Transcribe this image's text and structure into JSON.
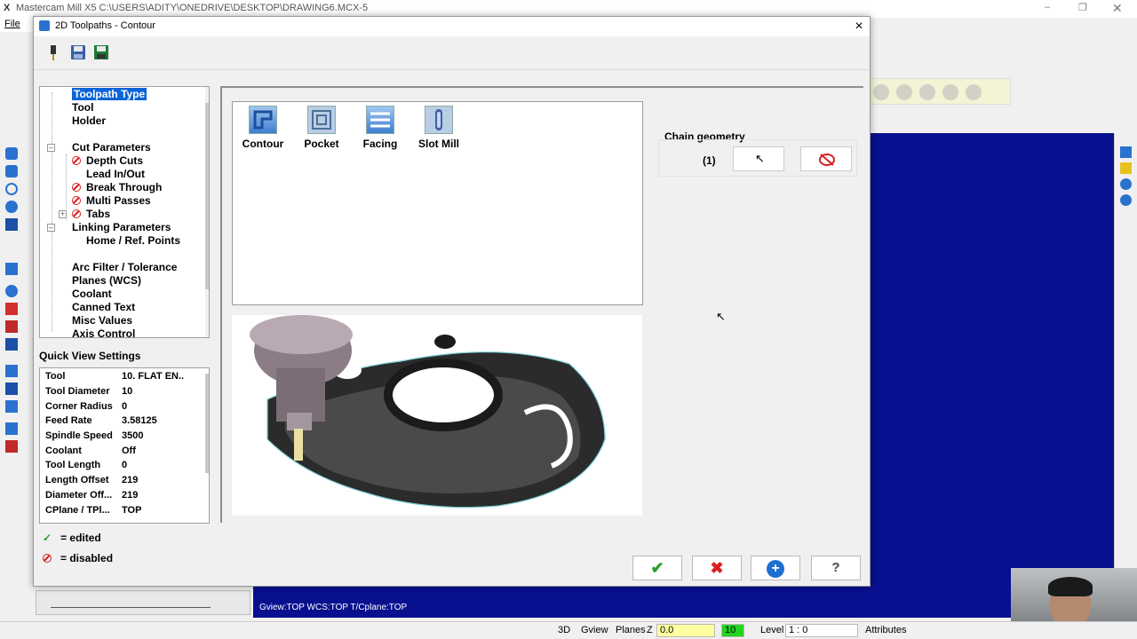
{
  "app": {
    "title": "Mastercam Mill X5  C:\\USERS\\ADITY\\ONEDRIVE\\DESKTOP\\DRAWING6.MCX-5",
    "menu_file": "File"
  },
  "dialog": {
    "title": "2D Toolpaths - Contour",
    "close": "×"
  },
  "tree": {
    "items": [
      {
        "label": "Toolpath Type"
      },
      {
        "label": "Tool"
      },
      {
        "label": "Holder"
      },
      {
        "label": "Cut Parameters"
      },
      {
        "label": "Depth Cuts"
      },
      {
        "label": "Lead In/Out"
      },
      {
        "label": "Break Through"
      },
      {
        "label": "Multi Passes"
      },
      {
        "label": "Tabs"
      },
      {
        "label": "Linking Parameters"
      },
      {
        "label": "Home / Ref. Points"
      },
      {
        "label": "Arc Filter / Tolerance"
      },
      {
        "label": "Planes (WCS)"
      },
      {
        "label": "Coolant"
      },
      {
        "label": "Canned Text"
      },
      {
        "label": "Misc Values"
      },
      {
        "label": "Axis Control"
      }
    ]
  },
  "quick_view": {
    "title": "Quick View Settings",
    "rows": [
      {
        "k": "Tool",
        "v": "10. FLAT EN.."
      },
      {
        "k": "Tool Diameter",
        "v": "10"
      },
      {
        "k": "Corner Radius",
        "v": "0"
      },
      {
        "k": "Feed Rate",
        "v": "3.58125"
      },
      {
        "k": "Spindle Speed",
        "v": "3500"
      },
      {
        "k": "Coolant",
        "v": "Off"
      },
      {
        "k": "Tool Length",
        "v": "0"
      },
      {
        "k": "Length Offset",
        "v": "219"
      },
      {
        "k": "Diameter Off...",
        "v": "219"
      },
      {
        "k": "CPlane / TPl...",
        "v": "TOP"
      }
    ]
  },
  "legend": {
    "edited": "= edited",
    "disabled": "= disabled"
  },
  "toolpath_types": [
    {
      "label": "Contour"
    },
    {
      "label": "Pocket"
    },
    {
      "label": "Facing"
    },
    {
      "label": "Slot Mill"
    }
  ],
  "chain": {
    "label": "Chain geometry",
    "count": "(1)"
  },
  "viewport_status": "Gview:TOP   WCS:TOP   T/Cplane:TOP",
  "statusbar": {
    "3d": "3D",
    "gview": "Gview",
    "planes": "Planes",
    "z_label": "Z",
    "z_value": "0.0",
    "color_value": "10",
    "level_label": "Level",
    "level_value": "1 : 0",
    "attributes": "Attributes"
  },
  "colors": {
    "viewport": "#08108f",
    "selection": "#0a64d8",
    "ok": "#2aa12a",
    "cancel": "#d8211f"
  }
}
